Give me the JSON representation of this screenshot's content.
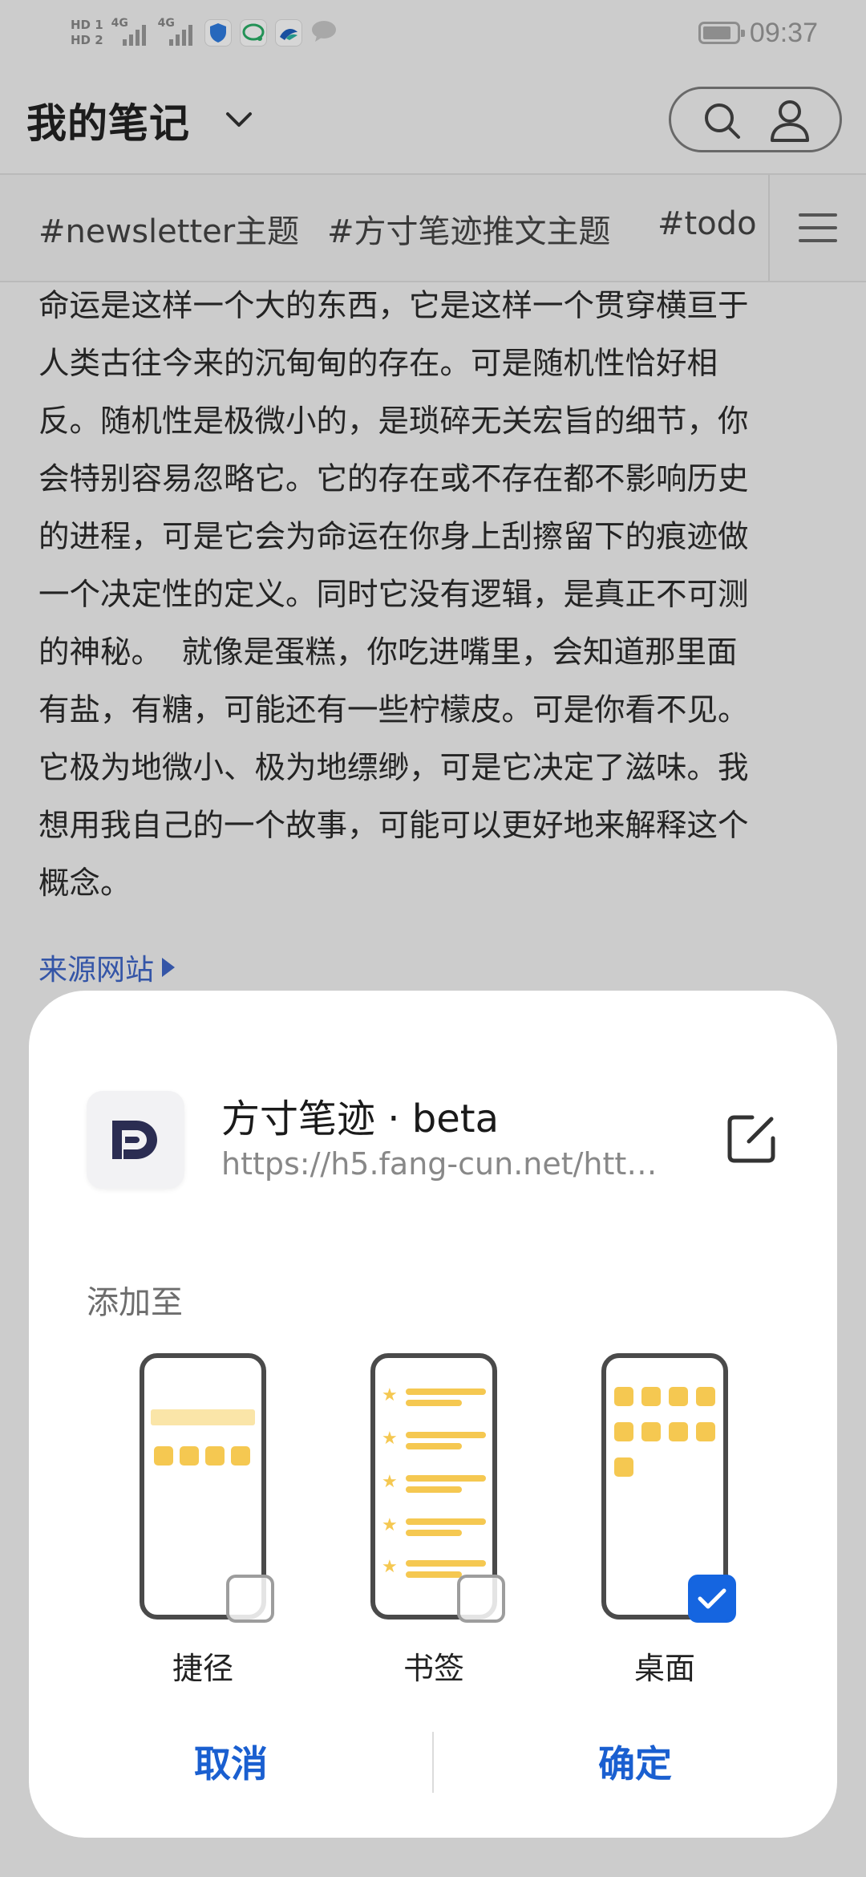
{
  "status_bar": {
    "hd1": "HD 1",
    "hd2": "HD 2",
    "net1": "4G",
    "net2": "4G",
    "time": "09:37",
    "battery_level": 0.85
  },
  "header": {
    "title": "我的笔记"
  },
  "tags": [
    "#newsletter主题",
    "#方寸笔迹推文主题",
    "#todo"
  ],
  "article": {
    "lines": [
      "命运是这样一个大的东西，它是这样一个贯穿横亘于",
      "人类古往今来的沉甸甸的存在。可是随机性恰好相",
      "反。随机性是极微小的，是琐碎无关宏旨的细节，你",
      "会特别容易忽略它。它的存在或不存在都不影响历史",
      "的进程，可是它会为命运在你身上刮擦留下的痕迹做",
      "一个决定性的定义。同时它没有逻辑，是真正不可测",
      "的神秘。  就像是蛋糕，你吃进嘴里，会知道那里面",
      "有盐，有糖，可能还有一些柠檬皮。可是你看不见。",
      "它极为地微小、极为地缥缈，可是它决定了滋味。我",
      "想用我自己的一个故事，可能可以更好地来解释这个",
      "概念。"
    ],
    "source_link": "来源网站"
  },
  "dialog": {
    "app_name": "方寸笔迹 · beta",
    "app_url": "https://h5.fang-cun.net/htt…",
    "add_to_label": "添加至",
    "options": [
      {
        "label": "捷径",
        "checked": false
      },
      {
        "label": "书签",
        "checked": false
      },
      {
        "label": "桌面",
        "checked": true
      }
    ],
    "cancel_label": "取消",
    "confirm_label": "确定",
    "accent_color": "#1565e0",
    "illustration_color": "#f5c851"
  }
}
